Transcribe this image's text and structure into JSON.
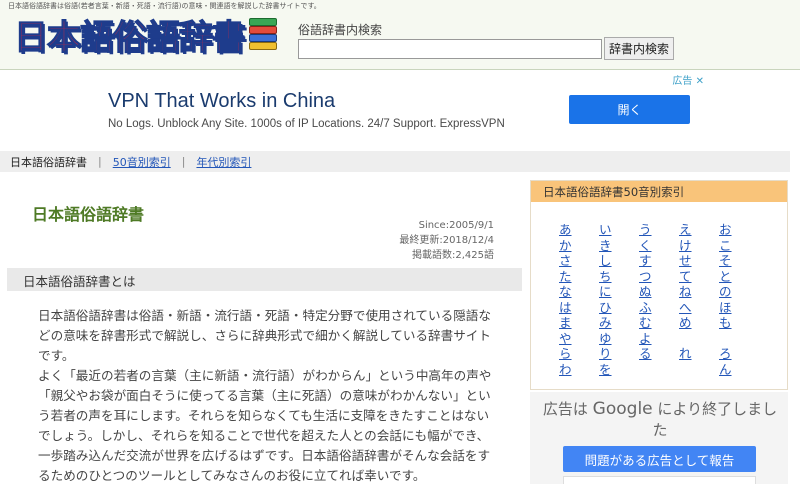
{
  "header": {
    "tagline": "日本語俗語辞書は俗語(若者言葉・新語・死語・流行語)の意味・関連語を解説した辞書サイトです。",
    "logo_text": "日本語俗語辞書",
    "search_label": "俗語辞書内検索",
    "search_value": "",
    "search_button": "辞書内検索"
  },
  "ad_top": {
    "title": "VPN That Works in China",
    "description": "No Logs. Unblock Any Site. 1000s of IP Locations. 24/7 Support. ExpressVPN",
    "button": "開く",
    "choices_label": "広告"
  },
  "nav": {
    "current": "日本語俗語辞書",
    "links": [
      "50音別索引",
      "年代別索引"
    ],
    "separator": "|"
  },
  "main": {
    "title": "日本語俗語辞書",
    "since": "Since:2005/9/1",
    "updated": "最終更新:2018/12/4",
    "count": "掲載語数:2,425語",
    "section_title": "日本語俗語辞書とは",
    "paragraphs": [
      "日本語俗語辞書は俗語・新語・流行語・死語・特定分野で使用されている隠語などの意味を辞書形式で解説し、さらに辞典形式で細かく解説している辞書サイトです。",
      "よく「最近の若者の言葉（主に新語・流行語）がわからん」という中高年の声や「親父やお袋が面白そうに使ってる言葉（主に死語）の意味がわかんない」という若者の声を耳にします。それらを知らなくても生活に支障をきたすことはないでしょう。しかし、それらを知ることで世代を超えた人との会話にも幅ができ、一歩踏み込んだ交流が世界を広げるはずです。日本語俗語辞書がそんな会話をするためのひとつのツールとしてみなさんのお役に立てれば幸いです。"
    ]
  },
  "index": {
    "title": "日本語俗語辞書50音別索引",
    "columns": [
      [
        "あ",
        "か",
        "さ",
        "た",
        "な",
        "は",
        "ま",
        "や",
        "ら",
        "わ"
      ],
      [
        "い",
        "き",
        "し",
        "ち",
        "に",
        "ひ",
        "み",
        "ゆ",
        "り",
        "を"
      ],
      [
        "う",
        "く",
        "す",
        "つ",
        "ぬ",
        "ふ",
        "む",
        "よ",
        "る"
      ],
      [
        "え",
        "け",
        "せ",
        "て",
        "ね",
        "へ",
        "め",
        "",
        "れ"
      ],
      [
        "お",
        "こ",
        "そ",
        "と",
        "の",
        "ほ",
        "も",
        "",
        "ろ",
        "ん"
      ]
    ]
  },
  "ad_end": {
    "text_prefix": "広告は",
    "brand": "Google",
    "text_suffix": "により終了しました",
    "button": "問題がある広告として報告"
  },
  "colors": {
    "logo_red": "#d7263d",
    "logo_blue": "#1e3c8c",
    "title_green": "#4e7a25",
    "link_blue": "#2356b8",
    "index_header": "#f9c47a",
    "ad_button": "#1a73e8"
  }
}
